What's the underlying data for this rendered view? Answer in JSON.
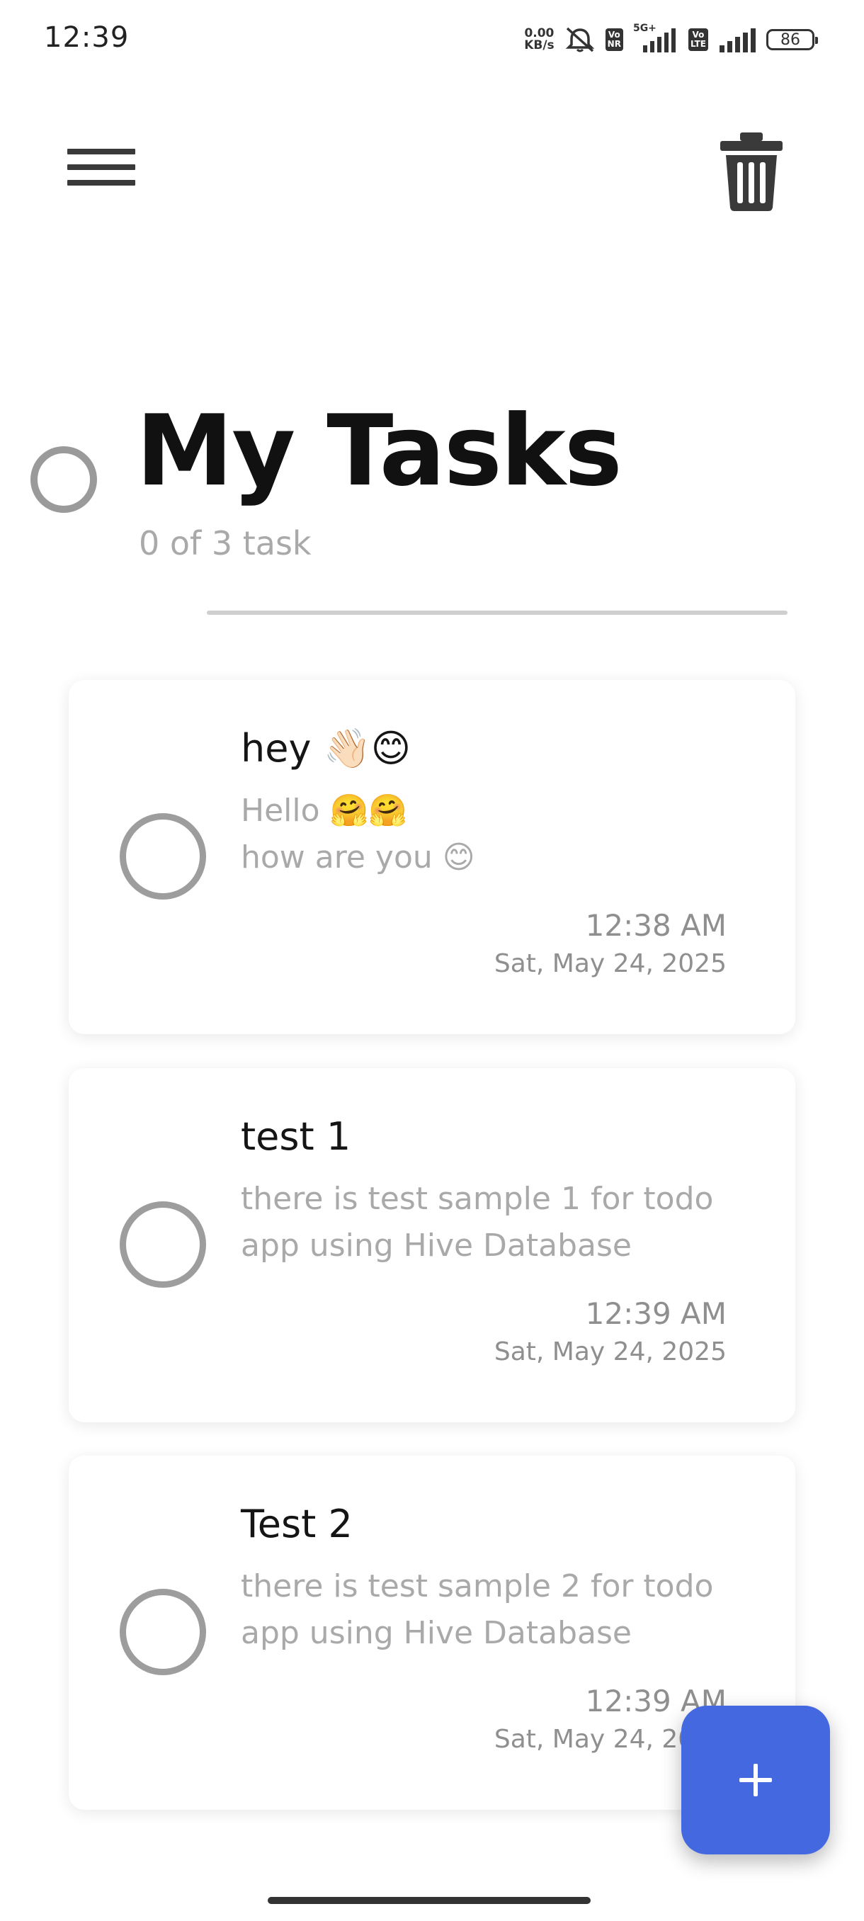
{
  "status_bar": {
    "time": "12:39",
    "net_speed_value": "0.00",
    "net_speed_unit": "KB/s",
    "vonr_tag_1": "Vo",
    "vonr_tag_2": "NR",
    "network_type": "5G+",
    "volte_tag_1": "Vo",
    "volte_tag_2": "LTE",
    "battery_level": "86",
    "icons": [
      "alarm-off-icon",
      "signal-icon",
      "signal-icon",
      "battery-icon"
    ]
  },
  "toolbar": {
    "menu_icon": "hamburger-menu-icon",
    "delete_icon": "trash-icon"
  },
  "header": {
    "title": "My Tasks",
    "task_count": "0 of 3 task",
    "progress_fraction": 0
  },
  "tasks": [
    {
      "title": "hey 👋🏻😊",
      "description": "Hello 🤗🤗\nhow are you 😊",
      "time": "12:38 AM",
      "date": "Sat, May 24, 2025",
      "completed": false
    },
    {
      "title": "test 1",
      "description": "there is test sample 1 for  todo app using Hive Database",
      "time": "12:39 AM",
      "date": "Sat, May 24, 2025",
      "completed": false
    },
    {
      "title": "Test 2",
      "description": "there is test sample 2 for  todo app using Hive Database",
      "time": "12:39 AM",
      "date": "Sat, May 24, 2025",
      "completed": false
    }
  ],
  "fab": {
    "icon": "plus-icon"
  },
  "colors": {
    "accent": "#4468e0",
    "circle_gray": "#9d9d9d",
    "secondary_text": "#a9a9a9"
  }
}
